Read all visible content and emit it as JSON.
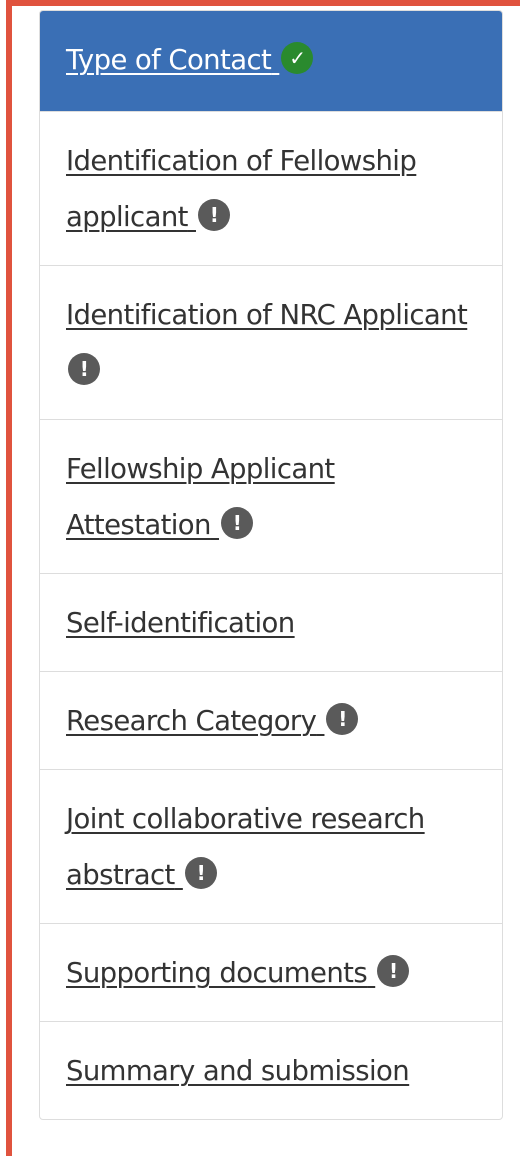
{
  "nav": {
    "items": [
      {
        "label": "Type of Contact",
        "status": "complete",
        "status_glyph": "✓",
        "active": true
      },
      {
        "label": "Identification of Fellowship applicant",
        "status": "warning",
        "status_glyph": "!"
      },
      {
        "label": "Identification of NRC Applicant",
        "status": "warning",
        "status_glyph": "!"
      },
      {
        "label": "Fellowship Applicant Attestation",
        "status": "warning",
        "status_glyph": "!"
      },
      {
        "label": "Self-identification",
        "status": "none"
      },
      {
        "label": "Research Category",
        "status": "warning",
        "status_glyph": "!"
      },
      {
        "label": "Joint collaborative research abstract",
        "status": "warning",
        "status_glyph": "!"
      },
      {
        "label": "Supporting documents",
        "status": "warning",
        "status_glyph": "!"
      },
      {
        "label": "Summary and submission",
        "status": "none"
      }
    ]
  },
  "colors": {
    "active_bg": "#3a6fb5",
    "complete": "#2a8a2e",
    "warning": "#5a5a5a",
    "frame": "#e0533e"
  }
}
